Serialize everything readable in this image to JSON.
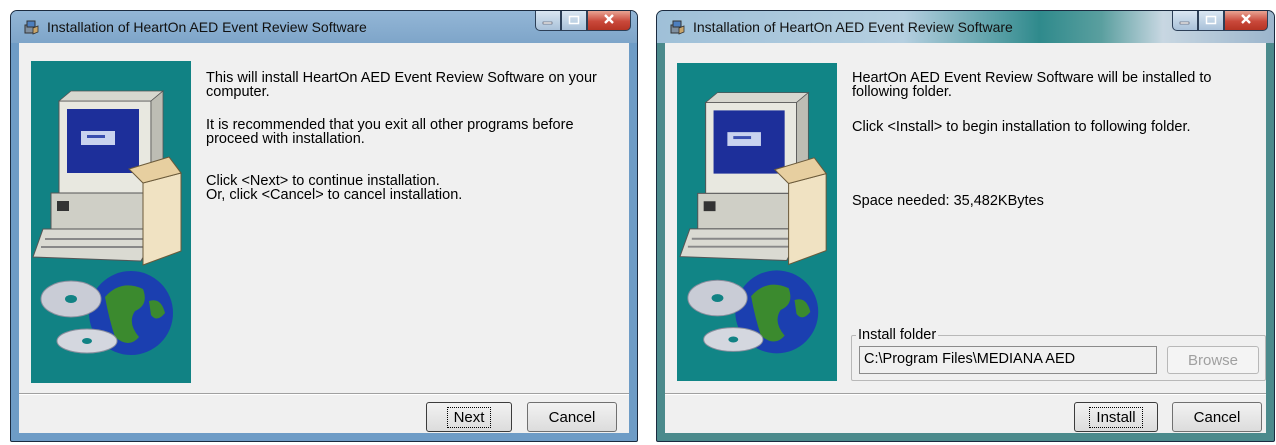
{
  "window1": {
    "title": "Installation of HeartOn AED Event Review Software",
    "para1": "This will install HeartOn AED Event Review Software on your computer.",
    "para2": "It is recommended that you exit all other programs before proceed with installation.",
    "para3_line1": "Click <Next> to continue installation.",
    "para3_line2": "Or, click <Cancel> to cancel installation.",
    "next_label": "Next",
    "cancel_label": "Cancel"
  },
  "window2": {
    "title": "Installation of HeartOn AED Event Review Software",
    "para1": "HeartOn AED Event Review Software will be installed to following folder.",
    "para2": "Click <Install> to begin installation to following folder.",
    "space_needed": "Space needed: 35,482KBytes",
    "install_folder_label": "Install folder",
    "install_folder_value": "C:\\Program Files\\MEDIANA AED",
    "browse_label": "Browse",
    "install_label": "Install",
    "cancel_label": "Cancel"
  },
  "icons": [
    "installer-icon",
    "minimize-icon",
    "maximize-icon",
    "close-icon",
    "computer-illustration",
    "globe-cd-illustration"
  ],
  "colors": {
    "side_panel": "#118284",
    "close_button": "#c9483a",
    "title_bar": "#7ea5c9"
  }
}
